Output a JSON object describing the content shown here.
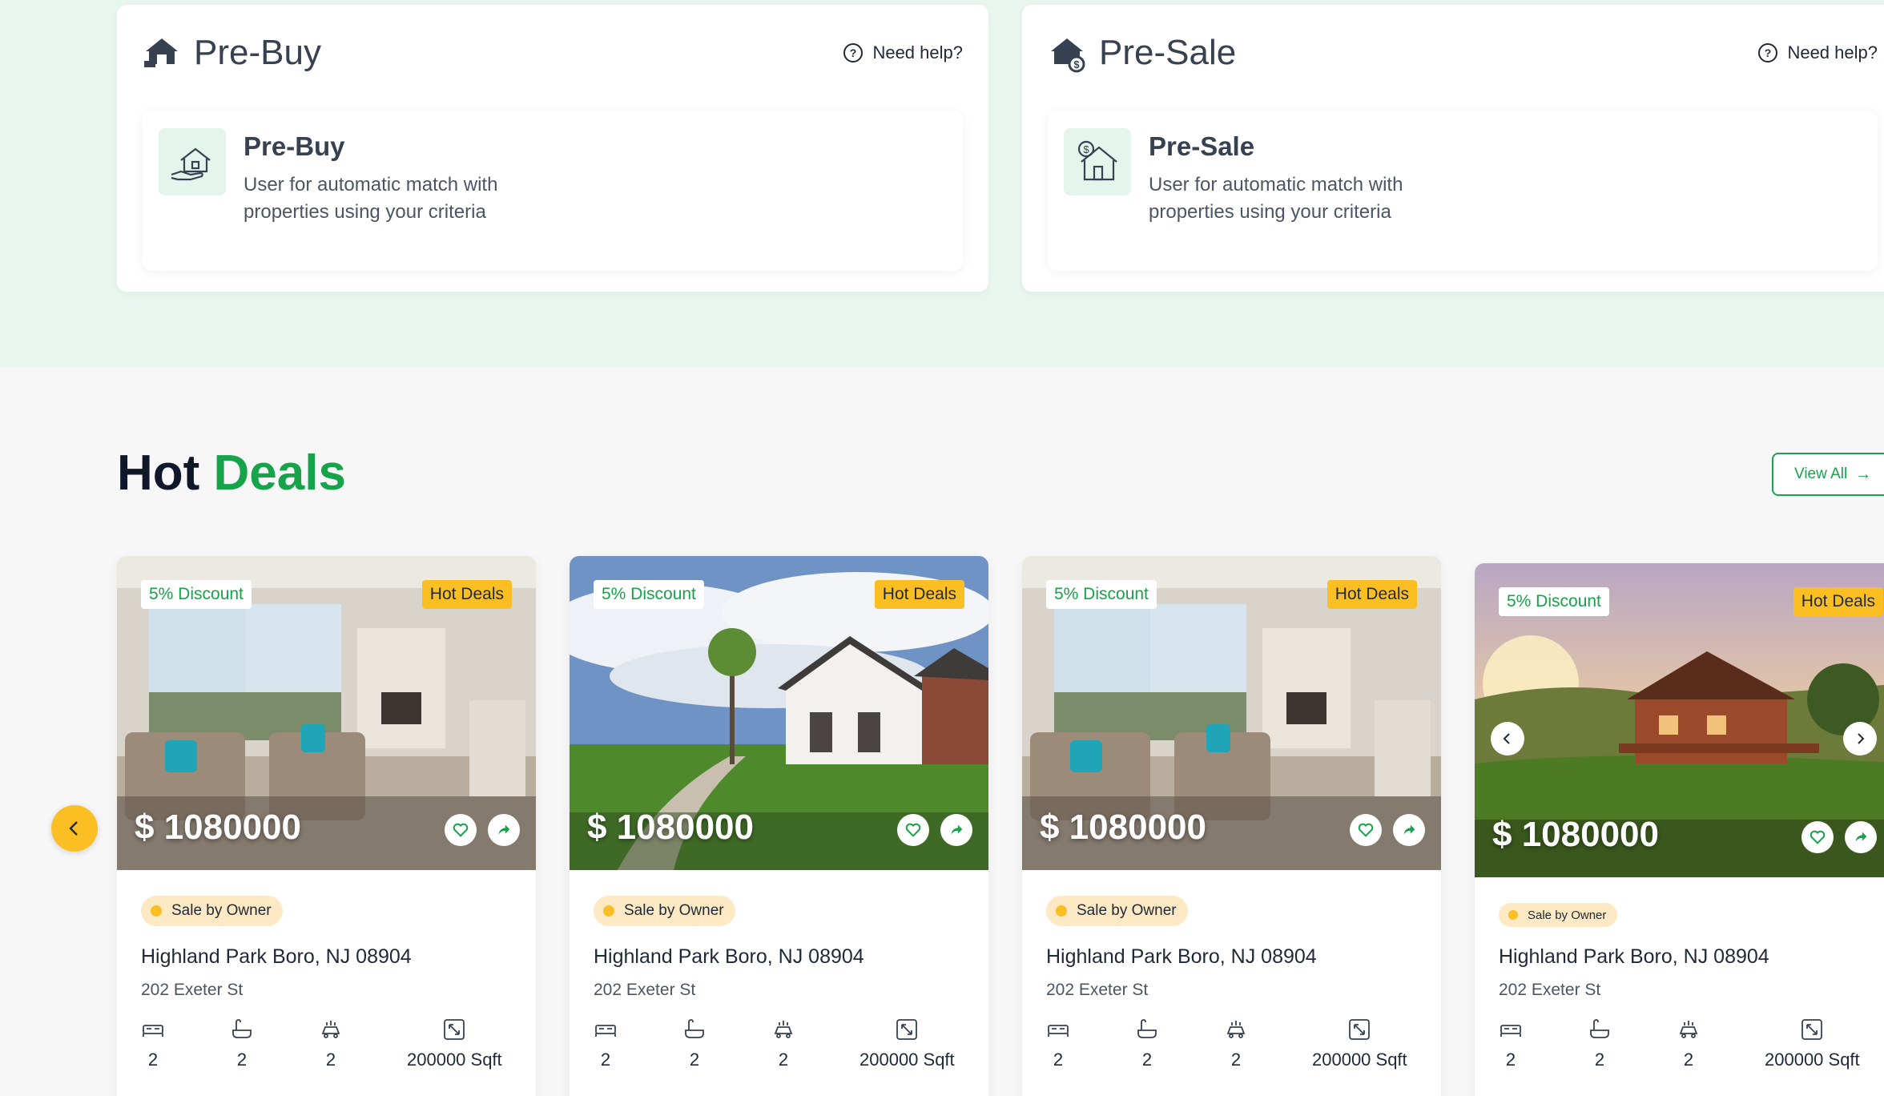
{
  "services": [
    {
      "title": "Pre-Buy",
      "need_help": "Need help?",
      "inner_title": "Pre-Buy",
      "inner_desc": "User for automatic match with properties using your criteria"
    },
    {
      "title": "Pre-Sale",
      "need_help": "Need help?",
      "inner_title": "Pre-Sale",
      "inner_desc": "User for automatic match with properties using your criteria"
    }
  ],
  "hot_deals": {
    "title_main": "Hot",
    "title_accent": "Deals",
    "view_all": "View All",
    "cards": [
      {
        "discount": "5% Discount",
        "hot": "Hot Deals",
        "price": "$ 1080000",
        "owner": "Sale by Owner",
        "address": "Highland Park Boro, NJ 08904",
        "street": "202 Exeter St",
        "beds": "2",
        "baths": "2",
        "parking": "2",
        "area": "200000 Sqft",
        "image": "living-room"
      },
      {
        "discount": "5% Discount",
        "hot": "Hot Deals",
        "price": "$ 1080000",
        "owner": "Sale by Owner",
        "address": "Highland Park Boro, NJ 08904",
        "street": "202 Exeter St",
        "beds": "2",
        "baths": "2",
        "parking": "2",
        "area": "200000 Sqft",
        "image": "house-exterior"
      },
      {
        "discount": "5% Discount",
        "hot": "Hot Deals",
        "price": "$ 1080000",
        "owner": "Sale by Owner",
        "address": "Highland Park Boro, NJ 08904",
        "street": "202 Exeter St",
        "beds": "2",
        "baths": "2",
        "parking": "2",
        "area": "200000 Sqft",
        "image": "living-room"
      },
      {
        "discount": "5% Discount",
        "hot": "Hot Deals",
        "price": "$ 1080000",
        "owner": "Sale by Owner",
        "address": "Highland Park Boro, NJ 08904",
        "street": "202 Exeter St",
        "beds": "2",
        "baths": "2",
        "parking": "2",
        "area": "200000 Sqft",
        "image": "cabin-sunset"
      }
    ]
  },
  "colors": {
    "accent": "#16a34a",
    "highlight": "#fbbf24",
    "band": "#e8f6ef"
  }
}
